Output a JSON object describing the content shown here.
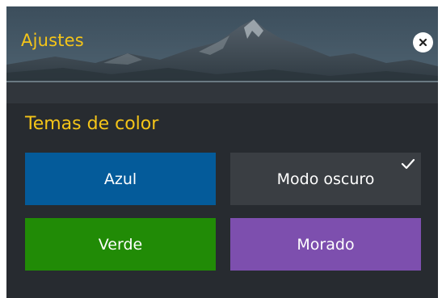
{
  "dialog": {
    "title": "Ajustes",
    "close_icon": "close-icon"
  },
  "themes": {
    "heading": "Temas de color",
    "options": [
      {
        "label": "Azul",
        "color": "#045b9a",
        "selected": false
      },
      {
        "label": "Modo oscuro",
        "color": "#3a3e43",
        "selected": true,
        "check_icon": "checkmark-icon"
      },
      {
        "label": "Verde",
        "color": "#218b06",
        "selected": false
      },
      {
        "label": "Morado",
        "color": "#7d4fae",
        "selected": false
      }
    ]
  },
  "colors": {
    "accent": "#f5c518",
    "panel_bg": "#272b30"
  }
}
